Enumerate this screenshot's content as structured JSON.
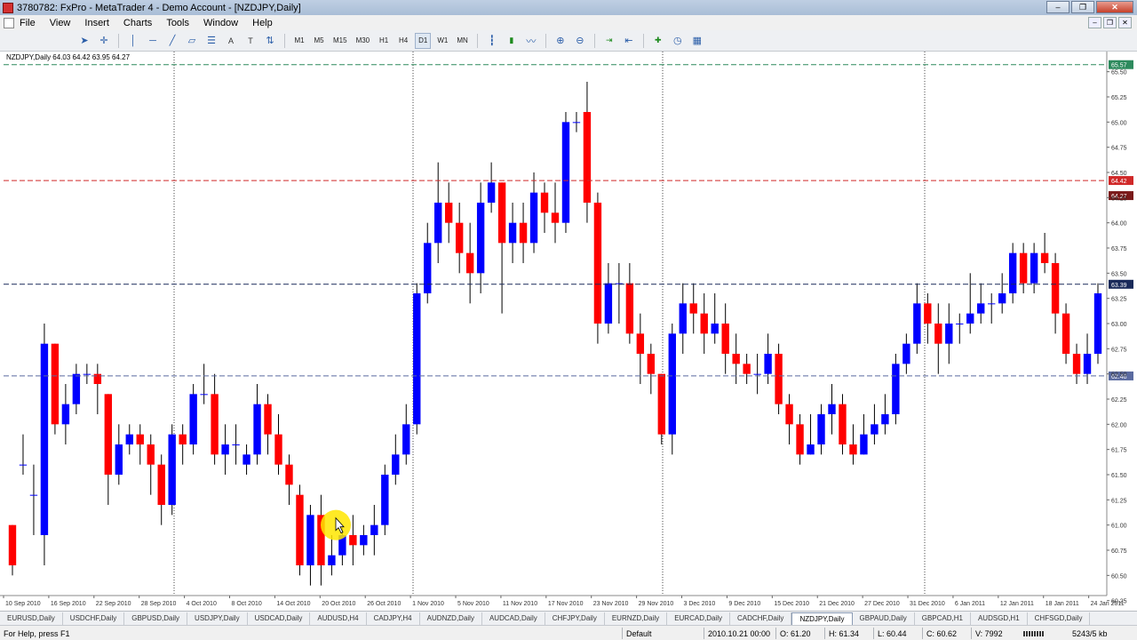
{
  "window": {
    "title": "3780782: FxPro - MetaTrader 4 - Demo Account - [NZDJPY,Daily]",
    "buttons": [
      "–",
      "❐",
      "✕"
    ]
  },
  "menu": {
    "items": [
      "File",
      "View",
      "Insert",
      "Charts",
      "Tools",
      "Window",
      "Help"
    ],
    "mdi_buttons": [
      "–",
      "❐",
      "✕"
    ]
  },
  "toolbar": {
    "timeframes": [
      "M1",
      "M5",
      "M15",
      "M30",
      "H1",
      "H4",
      "D1",
      "W1",
      "MN"
    ],
    "active_timeframe": "D1",
    "text_tool": "A",
    "label_tool": "T"
  },
  "chart": {
    "info": "NZDJPY,Daily  64.03 64.42 63.95 64.27",
    "cursor_label": "",
    "colors": {
      "bull": "#0000ff",
      "bear": "#ff0000",
      "bg": "#ffffff",
      "bid": "#7a1a1a",
      "ask": "#d02828",
      "hline_top": "#2d8a5d",
      "hline_mid": "#1a2a5a",
      "hline_low": "#5a6aa0"
    }
  },
  "chart_data": {
    "type": "candlestick",
    "symbol": "NZDJPY",
    "timeframe": "Daily",
    "ylim": [
      60.3,
      65.7
    ],
    "y_ticks": [
      "65.50",
      "65.25",
      "65.00",
      "64.75",
      "64.50",
      "64.25",
      "64.00",
      "63.75",
      "63.50",
      "63.25",
      "63.00",
      "62.75",
      "62.50",
      "62.25",
      "62.00",
      "61.75",
      "61.50",
      "61.25",
      "61.00",
      "60.75",
      "60.50",
      "60.25"
    ],
    "x_labels": [
      "10 Sep 2010",
      "16 Sep 2010",
      "22 Sep 2010",
      "28 Sep 2010",
      "4 Oct 2010",
      "8 Oct 2010",
      "14 Oct 2010",
      "20 Oct 2010",
      "26 Oct 2010",
      "1 Nov 2010",
      "5 Nov 2010",
      "11 Nov 2010",
      "17 Nov 2010",
      "23 Nov 2010",
      "29 Nov 2010",
      "3 Dec 2010",
      "9 Dec 2010",
      "15 Dec 2010",
      "21 Dec 2010",
      "27 Dec 2010",
      "31 Dec 2010",
      "6 Jan 2011",
      "12 Jan 2011",
      "18 Jan 2011",
      "24 Jan 2011"
    ],
    "horizontal_lines": [
      {
        "price": 65.57,
        "label": "65.57",
        "style": "top"
      },
      {
        "price": 64.42,
        "label": "64.42",
        "style": "ask"
      },
      {
        "price": 64.27,
        "label": "64.27",
        "style": "bid"
      },
      {
        "price": 63.39,
        "label": "63.39",
        "style": "mid"
      },
      {
        "price": 62.48,
        "label": "62.48",
        "style": "low"
      }
    ],
    "candles": [
      [
        61.0,
        60.6,
        61.0,
        60.5
      ],
      [
        61.6,
        61.6,
        61.9,
        61.5
      ],
      [
        61.3,
        61.3,
        61.6,
        60.9
      ],
      [
        60.9,
        62.8,
        63.0,
        60.6
      ],
      [
        62.8,
        62.0,
        62.8,
        61.9
      ],
      [
        62.0,
        62.2,
        62.4,
        61.8
      ],
      [
        62.2,
        62.5,
        62.6,
        62.1
      ],
      [
        62.5,
        62.5,
        62.6,
        62.4
      ],
      [
        62.5,
        62.4,
        62.6,
        62.1
      ],
      [
        62.3,
        61.5,
        62.3,
        61.2
      ],
      [
        61.5,
        61.8,
        62.0,
        61.4
      ],
      [
        61.8,
        61.9,
        62.0,
        61.7
      ],
      [
        61.9,
        61.8,
        62.0,
        61.6
      ],
      [
        61.8,
        61.6,
        61.9,
        61.3
      ],
      [
        61.6,
        61.2,
        61.7,
        61.0
      ],
      [
        61.2,
        61.9,
        62.0,
        61.1
      ],
      [
        61.9,
        61.8,
        62.0,
        61.6
      ],
      [
        61.8,
        62.3,
        62.4,
        61.7
      ],
      [
        62.3,
        62.3,
        62.6,
        62.2
      ],
      [
        62.3,
        61.7,
        62.5,
        61.6
      ],
      [
        61.7,
        61.8,
        62.0,
        61.5
      ],
      [
        61.8,
        61.8,
        62.0,
        61.6
      ],
      [
        61.6,
        61.7,
        61.8,
        61.5
      ],
      [
        61.7,
        62.2,
        62.4,
        61.6
      ],
      [
        62.2,
        61.9,
        62.3,
        61.7
      ],
      [
        61.9,
        61.6,
        62.1,
        61.5
      ],
      [
        61.6,
        61.4,
        61.7,
        61.2
      ],
      [
        61.3,
        60.6,
        61.4,
        60.5
      ],
      [
        60.6,
        61.1,
        61.2,
        60.4
      ],
      [
        61.1,
        60.6,
        61.3,
        60.4
      ],
      [
        60.6,
        60.7,
        60.9,
        60.5
      ],
      [
        60.7,
        60.9,
        61.0,
        60.6
      ],
      [
        60.9,
        60.8,
        61.1,
        60.6
      ],
      [
        60.8,
        60.9,
        61.0,
        60.7
      ],
      [
        60.9,
        61.0,
        61.2,
        60.7
      ],
      [
        61.0,
        61.5,
        61.6,
        60.9
      ],
      [
        61.5,
        61.7,
        61.9,
        61.4
      ],
      [
        61.7,
        62.0,
        62.2,
        61.6
      ],
      [
        62.0,
        63.3,
        63.4,
        61.9
      ],
      [
        63.3,
        63.8,
        64.0,
        63.2
      ],
      [
        63.8,
        64.2,
        64.6,
        63.6
      ],
      [
        64.2,
        64.0,
        64.4,
        63.8
      ],
      [
        64.0,
        63.7,
        64.2,
        63.5
      ],
      [
        63.7,
        63.5,
        64.0,
        63.2
      ],
      [
        63.5,
        64.2,
        64.4,
        63.3
      ],
      [
        64.2,
        64.4,
        64.6,
        64.1
      ],
      [
        64.4,
        63.8,
        64.4,
        63.1
      ],
      [
        63.8,
        64.0,
        64.2,
        63.6
      ],
      [
        64.0,
        63.8,
        64.2,
        63.6
      ],
      [
        63.8,
        64.3,
        64.5,
        63.7
      ],
      [
        64.3,
        64.1,
        64.4,
        63.9
      ],
      [
        64.1,
        64.0,
        64.4,
        63.8
      ],
      [
        64.0,
        65.0,
        65.1,
        63.9
      ],
      [
        65.0,
        65.0,
        65.1,
        64.9
      ],
      [
        65.1,
        64.2,
        65.4,
        64.0
      ],
      [
        64.2,
        63.0,
        64.3,
        62.8
      ],
      [
        63.0,
        63.4,
        63.6,
        62.9
      ],
      [
        63.4,
        63.4,
        63.6,
        63.0
      ],
      [
        63.4,
        62.9,
        63.6,
        62.8
      ],
      [
        62.9,
        62.7,
        63.1,
        62.4
      ],
      [
        62.7,
        62.5,
        62.8,
        62.3
      ],
      [
        62.5,
        61.9,
        62.5,
        61.8
      ],
      [
        61.9,
        62.9,
        63.0,
        61.7
      ],
      [
        62.9,
        63.2,
        63.4,
        62.7
      ],
      [
        63.2,
        63.1,
        63.4,
        62.9
      ],
      [
        63.1,
        62.9,
        63.3,
        62.7
      ],
      [
        62.9,
        63.0,
        63.3,
        62.8
      ],
      [
        63.0,
        62.7,
        63.2,
        62.5
      ],
      [
        62.7,
        62.6,
        62.9,
        62.4
      ],
      [
        62.6,
        62.5,
        62.7,
        62.4
      ],
      [
        62.5,
        62.5,
        62.7,
        62.3
      ],
      [
        62.5,
        62.7,
        62.9,
        62.4
      ],
      [
        62.7,
        62.2,
        62.8,
        62.1
      ],
      [
        62.2,
        62.0,
        62.3,
        61.8
      ],
      [
        62.0,
        61.7,
        62.1,
        61.6
      ],
      [
        61.7,
        61.8,
        62.1,
        61.7
      ],
      [
        61.8,
        62.1,
        62.2,
        61.7
      ],
      [
        62.1,
        62.2,
        62.4,
        61.9
      ],
      [
        62.2,
        61.8,
        62.3,
        61.7
      ],
      [
        61.8,
        61.7,
        62.0,
        61.6
      ],
      [
        61.7,
        61.9,
        62.1,
        61.7
      ],
      [
        61.9,
        62.0,
        62.2,
        61.8
      ],
      [
        62.0,
        62.1,
        62.3,
        61.9
      ],
      [
        62.1,
        62.6,
        62.7,
        62.0
      ],
      [
        62.6,
        62.8,
        62.9,
        62.5
      ],
      [
        62.8,
        63.2,
        63.4,
        62.7
      ],
      [
        63.2,
        63.0,
        63.3,
        62.8
      ],
      [
        63.0,
        62.8,
        63.2,
        62.5
      ],
      [
        62.8,
        63.0,
        63.2,
        62.6
      ],
      [
        63.0,
        63.0,
        63.1,
        62.8
      ],
      [
        63.0,
        63.1,
        63.5,
        62.9
      ],
      [
        63.1,
        63.2,
        63.4,
        63.0
      ],
      [
        63.2,
        63.2,
        63.3,
        63.0
      ],
      [
        63.2,
        63.3,
        63.5,
        63.1
      ],
      [
        63.3,
        63.7,
        63.8,
        63.2
      ],
      [
        63.7,
        63.4,
        63.8,
        63.3
      ],
      [
        63.4,
        63.7,
        63.8,
        63.3
      ],
      [
        63.7,
        63.6,
        63.9,
        63.5
      ],
      [
        63.6,
        63.1,
        63.7,
        62.9
      ],
      [
        63.1,
        62.7,
        63.2,
        62.6
      ],
      [
        62.7,
        62.5,
        62.8,
        62.4
      ],
      [
        62.5,
        62.7,
        62.9,
        62.4
      ],
      [
        62.7,
        63.3,
        63.4,
        62.6
      ]
    ]
  },
  "tabs": {
    "items": [
      "EURUSD,Daily",
      "USDCHF,Daily",
      "GBPUSD,Daily",
      "USDJPY,Daily",
      "USDCAD,Daily",
      "AUDUSD,H4",
      "CADJPY,H4",
      "AUDNZD,Daily",
      "AUDCAD,Daily",
      "CHFJPY,Daily",
      "EURNZD,Daily",
      "EURCAD,Daily",
      "CADCHF,Daily",
      "NZDJPY,Daily",
      "GBPAUD,Daily",
      "GBPCAD,H1",
      "AUDSGD,H1",
      "CHFSGD,Daily"
    ],
    "active": "NZDJPY,Daily"
  },
  "status": {
    "help": "For Help, press F1",
    "profile": "Default",
    "datetime": "2010.10.21 00:00",
    "open": "O: 61.20",
    "high": "H: 61.34",
    "low": "L: 60.44",
    "close": "C: 60.62",
    "volume": "V: 7992",
    "traffic": "5243/5 kb"
  }
}
